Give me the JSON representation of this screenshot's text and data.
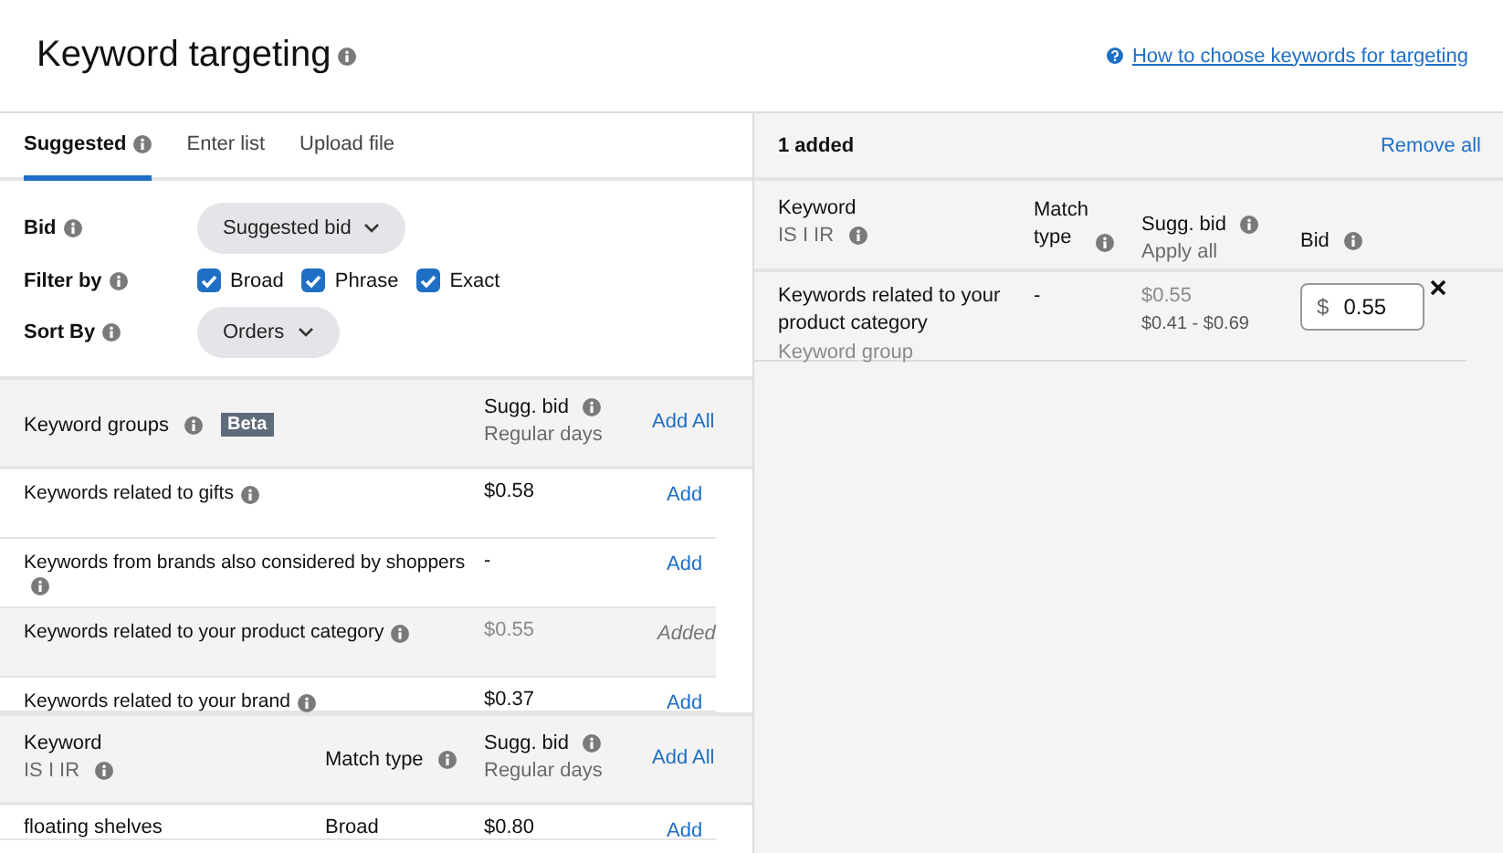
{
  "header": {
    "title": "Keyword targeting",
    "help_link": "How to choose keywords for targeting"
  },
  "tabs": [
    {
      "label": "Suggested",
      "info": true,
      "selected": true
    },
    {
      "label": "Enter list",
      "info": false,
      "selected": false
    },
    {
      "label": "Upload file",
      "info": false,
      "selected": false
    }
  ],
  "bid": {
    "label": "Bid",
    "value": "Suggested bid"
  },
  "filter": {
    "label": "Filter by",
    "options": [
      {
        "label": "Broad",
        "checked": true
      },
      {
        "label": "Phrase",
        "checked": true
      },
      {
        "label": "Exact",
        "checked": true
      }
    ]
  },
  "sort": {
    "label": "Sort By",
    "value": "Orders"
  },
  "groups": {
    "heading": "Keyword groups",
    "badge": "Beta",
    "bid_heading": "Sugg. bid",
    "bid_sub": "Regular days",
    "add_all": "Add All",
    "rows": [
      {
        "name": "Keywords related to gifts",
        "bid": "$0.58",
        "action": "Add",
        "added": false
      },
      {
        "name": "Keywords from brands also considered by shoppers",
        "bid": "-",
        "action": "Add",
        "added": false
      },
      {
        "name": "Keywords related to your product category",
        "bid": "$0.55",
        "action": "Added",
        "added": true
      },
      {
        "name": "Keywords related to your brand",
        "bid": "$0.37",
        "action": "Add",
        "added": false
      }
    ]
  },
  "keywords": {
    "heading": "Keyword",
    "keyword_sub": "IS I IR",
    "match_heading": "Match type",
    "bid_heading": "Sugg. bid",
    "bid_sub": "Regular days",
    "add_all": "Add All",
    "rows": [
      {
        "keyword": "floating shelves",
        "match": "Broad",
        "bid": "$0.80",
        "action": "Add"
      }
    ]
  },
  "added": {
    "count": "1 added",
    "remove_all": "Remove all",
    "heading": "Keyword",
    "keyword_sub": "IS I IR",
    "match_heading": "Match type",
    "bid_heading": "Sugg. bid",
    "bid_sub": "Apply all",
    "value_heading": "Bid",
    "rows": [
      {
        "keyword": "Keywords related to your product category",
        "match": "-",
        "bid": "$0.55",
        "range": "$0.41 - $0.69",
        "type": "Keyword group",
        "currency": "$",
        "value": "0.55"
      }
    ]
  }
}
